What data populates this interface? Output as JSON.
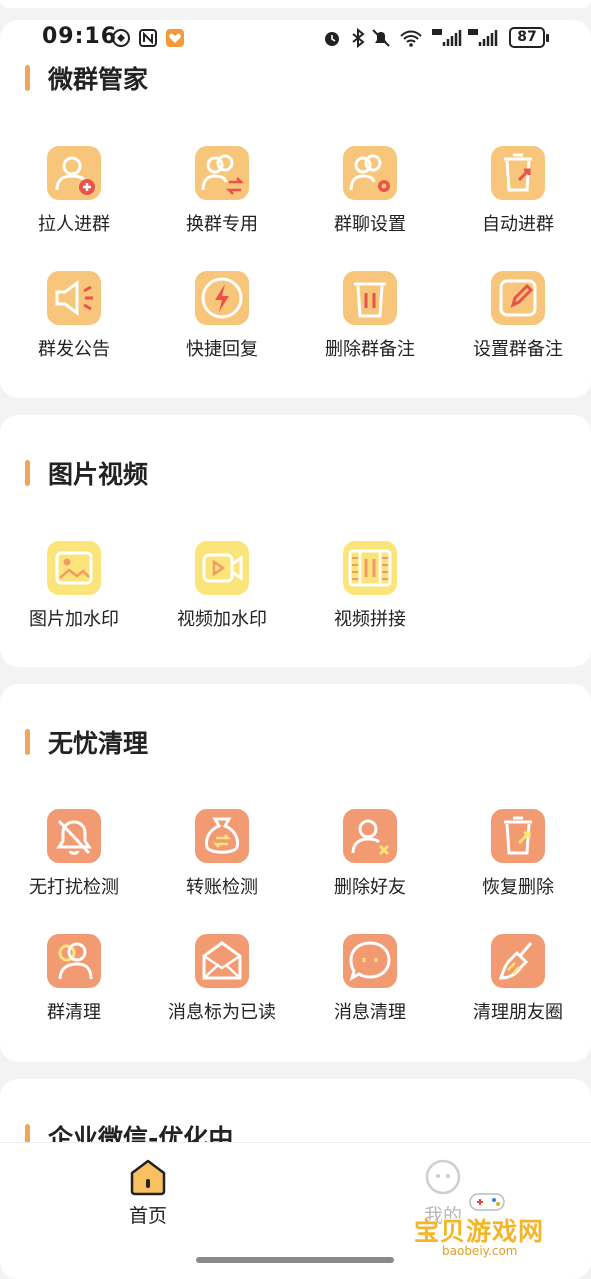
{
  "status_bar": {
    "time": "09:16",
    "battery": "87"
  },
  "sections": [
    {
      "title": "微群管家",
      "items": [
        "拉人进群",
        "换群专用",
        "群聊设置",
        "自动进群",
        "群发公告",
        "快捷回复",
        "删除群备注",
        "设置群备注"
      ]
    },
    {
      "title": "图片视频",
      "items": [
        "图片加水印",
        "视频加水印",
        "视频拼接"
      ]
    },
    {
      "title": "无忧清理",
      "items": [
        "无打扰检测",
        "转账检测",
        "删除好友",
        "恢复删除",
        "群清理",
        "消息标为已读",
        "消息清理",
        "清理朋友圈"
      ]
    },
    {
      "title": "企业微信-优化中",
      "items": []
    }
  ],
  "tabbar": {
    "home": "首页",
    "mine": "我的"
  },
  "watermark": {
    "title": "宝贝游戏网",
    "url": "baobeiy.com"
  },
  "colors": {
    "accent": "#f0a55a",
    "yellow_icon": "#fbe57a",
    "salmon_icon": "#f29a72"
  }
}
